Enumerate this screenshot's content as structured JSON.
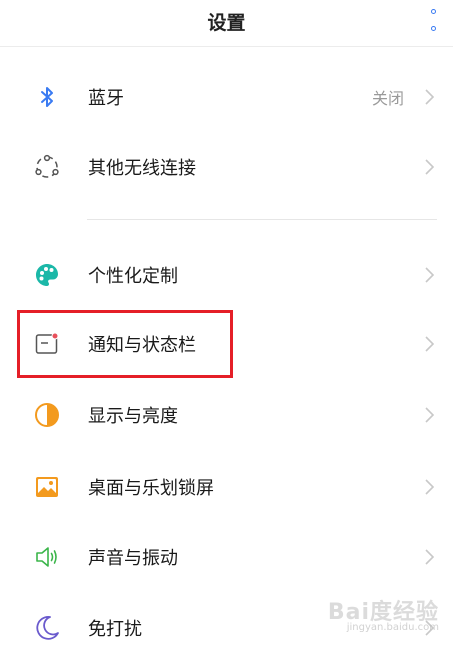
{
  "header": {
    "title": "设置"
  },
  "items": [
    {
      "label": "蓝牙",
      "value": "关闭",
      "icon": "bluetooth-icon"
    },
    {
      "label": "其他无线连接",
      "icon": "wireless-icon"
    },
    {
      "label": "个性化定制",
      "icon": "palette-icon"
    },
    {
      "label": "通知与状态栏",
      "icon": "notification-icon"
    },
    {
      "label": "显示与亮度",
      "icon": "brightness-icon"
    },
    {
      "label": "桌面与乐划锁屏",
      "icon": "wallpaper-icon"
    },
    {
      "label": "声音与振动",
      "icon": "speaker-icon"
    },
    {
      "label": "免打扰",
      "icon": "moon-icon"
    }
  ],
  "watermark": {
    "brand": "Bai度经验",
    "url": "jingyan.baidu.com"
  },
  "colors": {
    "accent": "#3a7bf2",
    "highlight": "#e51f28",
    "bluetooth": "#3a7bf2"
  }
}
